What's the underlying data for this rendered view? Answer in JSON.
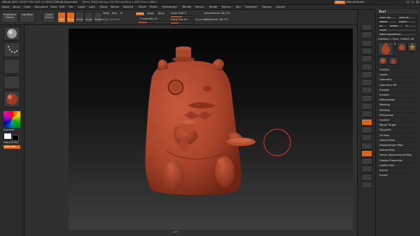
{
  "window": {
    "title": "ZBrush 2021",
    "file_info": "[DMM 9969 PAM 24 DRNIS]",
    "document": "ZBrush Document",
    "mem": "[Mem 7563] Memory 23178 Free Polys 1.466 Timer 0.886 1",
    "menu_label": "Menus",
    "default_script": "DefaultZScript",
    "accent_color": "#e06a1c"
  },
  "menubar": {
    "items": [
      "Alpha",
      "Brush",
      "Color",
      "Document",
      "Draw",
      "Edit",
      "File",
      "Layer",
      "Light",
      "Macro",
      "Marker",
      "Material",
      "Movie",
      "Picker",
      "Preferences",
      "Render",
      "Stencil",
      "Stroke",
      "Texture",
      "Tool",
      "Transform",
      "Zplugin",
      "Zscript"
    ]
  },
  "topshelf": {
    "projection_master": "Projection Master",
    "lightbox": "LightBox",
    "quick_sketch": "Quick Sketch",
    "edit": "Edit",
    "draw": "Draw",
    "move": "Move",
    "scale": "Scale",
    "rotate": "Rotate",
    "mrgb": "Mrgb",
    "rgb": "Rgb",
    "m": "M",
    "zadd": "Zadd",
    "zsub": "Zsub",
    "zcut": "Zcut",
    "rgb_intensity": "Rgb Intensity",
    "z_intensity": "Z Intensity 25",
    "focal_shift": "Focal Shift 0",
    "draw_size": "Draw Size 64",
    "dynamic": "Dynamic",
    "active_points": "ActivePoints: 66,772",
    "total_points": "TotalPoints: 66,772"
  },
  "leftshelf": {
    "gradient_label": "Gradient",
    "switch_color_label": "SwitchColor",
    "alternate_label": "Alternate"
  },
  "rightshelf": {
    "buttons": [
      "BPR",
      "SPix 3",
      "Scroll",
      "Zoom",
      "Actual",
      "AAHalf",
      "Persp",
      "Floor",
      "Local",
      "LSym",
      "Xyz",
      "Frame",
      "Move",
      "Scale",
      "Rotate",
      "Line Fill",
      "PolyF",
      "Transp",
      "Ghost",
      "Solo",
      "Xpose"
    ]
  },
  "toolpanel": {
    "title": "Tool",
    "load_tool": "Load Tool",
    "save_as": "Save As",
    "copy_tool": "Copy Tool",
    "paste_tool": "Paste Tool",
    "import": "Import",
    "export": "Export",
    "clone": "Clone",
    "make_polymesh": "Make PolyMesh3D",
    "goz": "GoZ",
    "all": "All",
    "visible": "Visible",
    "r": "R",
    "lightbox_tools": "Lightbox > Tools",
    "current_tool": "CatMan 48",
    "tool_label_r": "R",
    "thumb_labels": [
      "CatMan 48",
      "PolyMesh3D",
      "SimpleBrush",
      "CatMan 48"
    ],
    "sections": [
      "SubTool",
      "Layers",
      "Geometry",
      "Geometry HD",
      "Preview",
      "Surface",
      "Deformation",
      "Masking",
      "Visibility",
      "Polygroups",
      "Contact",
      "Morph Target",
      "Polypaint",
      "UV Map",
      "Texture Map",
      "Displacement Map",
      "Normal Map",
      "Vector Displacement Map",
      "Display Properties",
      "Unified Skin",
      "Import",
      "Export"
    ]
  },
  "sculpt": {
    "model_color": "#b1452a",
    "brush_cursor_color": "#c0362b"
  }
}
